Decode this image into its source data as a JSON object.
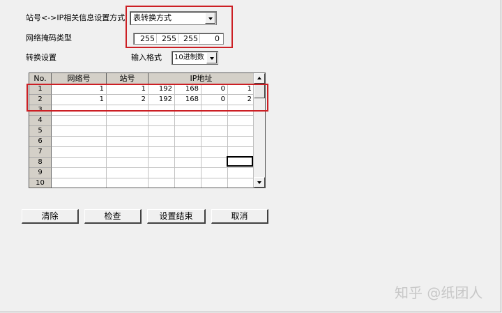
{
  "labels": {
    "mapping_method": "站号<->IP相关信息设置方式",
    "subnet_mask_type": "网络掩码类型",
    "conversion_settings": "转换设置",
    "input_format": "输入格式"
  },
  "mapping_method_value": "表转换方式",
  "input_format_value": "10进制数",
  "subnet_mask": [
    "255",
    "255",
    "255",
    "0"
  ],
  "table": {
    "columns": [
      "No.",
      "网络号",
      "站号",
      "IP地址"
    ],
    "rows": [
      {
        "no": "1",
        "network": "1",
        "station": "1",
        "ip": [
          "192",
          "168",
          "0",
          "1"
        ]
      },
      {
        "no": "2",
        "network": "1",
        "station": "2",
        "ip": [
          "192",
          "168",
          "0",
          "2"
        ]
      },
      {
        "no": "3",
        "network": "",
        "station": "",
        "ip": [
          "",
          "",
          "",
          ""
        ]
      },
      {
        "no": "4",
        "network": "",
        "station": "",
        "ip": [
          "",
          "",
          "",
          ""
        ]
      },
      {
        "no": "5",
        "network": "",
        "station": "",
        "ip": [
          "",
          "",
          "",
          ""
        ]
      },
      {
        "no": "6",
        "network": "",
        "station": "",
        "ip": [
          "",
          "",
          "",
          ""
        ]
      },
      {
        "no": "7",
        "network": "",
        "station": "",
        "ip": [
          "",
          "",
          "",
          ""
        ]
      },
      {
        "no": "8",
        "network": "",
        "station": "",
        "ip": [
          "",
          "",
          "",
          ""
        ]
      },
      {
        "no": "9",
        "network": "",
        "station": "",
        "ip": [
          "",
          "",
          "",
          ""
        ]
      },
      {
        "no": "10",
        "network": "",
        "station": "",
        "ip": [
          "",
          "",
          "",
          ""
        ]
      }
    ]
  },
  "buttons": {
    "clear": "清除",
    "check": "检查",
    "finish": "设置结束",
    "cancel": "取消"
  },
  "watermark": "知乎 @纸团人",
  "colors": {
    "highlight_red": "#cc1f24",
    "dialog_bg": "#f0f0f0"
  }
}
